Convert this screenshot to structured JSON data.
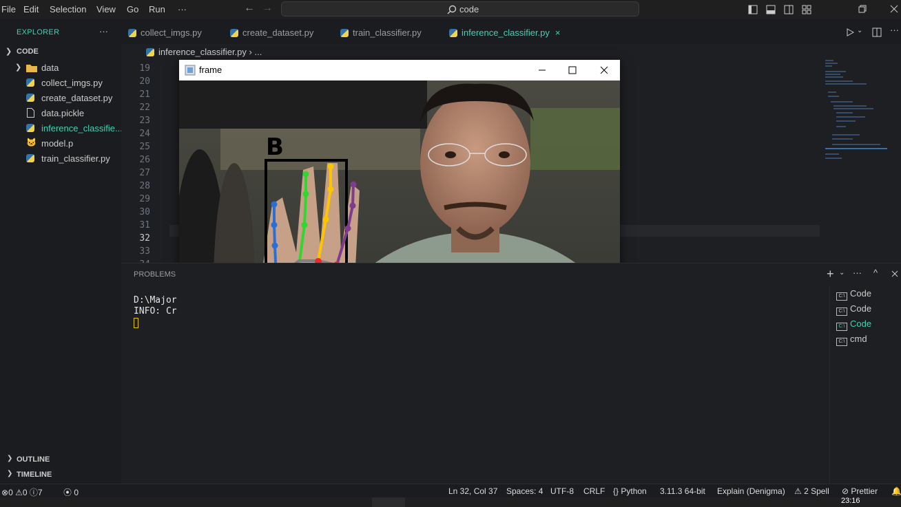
{
  "menu": [
    "File",
    "Edit",
    "Selection",
    "View",
    "Go",
    "Run",
    "···"
  ],
  "search": {
    "text": "code"
  },
  "explorer": {
    "title": "EXPLORER",
    "more": "···",
    "folder": "CODE",
    "items": [
      {
        "label": "data",
        "icon": "folder-icon"
      },
      {
        "label": "collect_imgs.py",
        "icon": "python-icon"
      },
      {
        "label": "create_dataset.py",
        "icon": "python-icon"
      },
      {
        "label": "data.pickle",
        "icon": "file-icon"
      },
      {
        "label": "inference_classifie...",
        "icon": "python-icon"
      },
      {
        "label": "model.p",
        "icon": "cat-icon"
      },
      {
        "label": "train_classifier.py",
        "icon": "python-icon"
      }
    ],
    "outline": "OUTLINE",
    "timeline": "TIMELINE"
  },
  "tabs": [
    {
      "label": "collect_imgs.py"
    },
    {
      "label": "create_dataset.py"
    },
    {
      "label": "train_classifier.py"
    },
    {
      "label": "inference_classifier.py",
      "close": "×"
    }
  ],
  "breadcrumb": {
    "file": "inference_classifier.py",
    "sep": "›",
    "more": "..."
  },
  "editor": {
    "line_numbers": [
      "19",
      "20",
      "21",
      "22",
      "23",
      "24",
      "25",
      "26",
      "27",
      "28",
      "29",
      "30",
      "31",
      "32",
      "33",
      "34"
    ],
    "current_line": "32"
  },
  "panel": {
    "tab": "PROBLEMS",
    "terminal_lines": [
      "D:\\Major",
      "INFO: Cr"
    ],
    "terminals": [
      "Code",
      "Code",
      "Code",
      "cmd"
    ]
  },
  "frame_window": {
    "title": "frame",
    "predicted_label": "B"
  },
  "status": {
    "errors": "0",
    "warnings": "0",
    "info": "7",
    "ports": "0",
    "position": "Ln 32, Col 37",
    "spaces": "Spaces: 4",
    "encoding": "UTF-8",
    "eol": "CRLF",
    "language": "Python",
    "interpreter": "3.11.3 64-bit",
    "explain": "Explain (Denigma)",
    "spell": "2 Spell",
    "prettier": "Prettier"
  },
  "taskbar": {
    "time": "23:16"
  },
  "colors": {
    "accent": "#3fd2b4",
    "background": "#1e1f22",
    "terminal_active": "#3fd2b4"
  }
}
